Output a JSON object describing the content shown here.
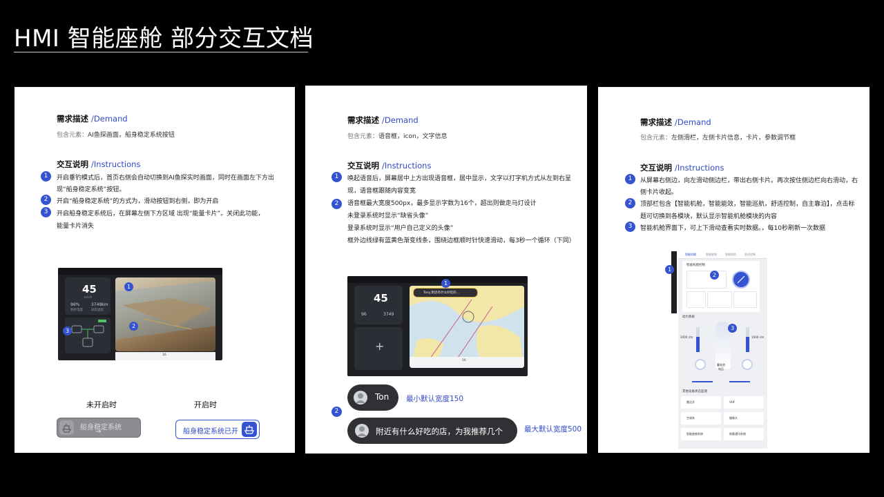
{
  "page": {
    "title": "HMI 智能座舱 部分交互文档"
  },
  "card1": {
    "demand_h": "需求描述",
    "demand_en": "/Demand",
    "elements_k": "包含元素：",
    "elements_v": "AI鱼探画面，船身稳定系统按钮",
    "instr_h": "交互说明",
    "instr_en": "/Instructions",
    "items": [
      "开启垂钓模式后，首页右侧会自动切换到AI鱼探实时画面，同时在画面左下方出",
      "现“船身稳定系统”按钮。",
      "开启“船身稳定系统”的方式为，滑动按钮到右侧，即为开启",
      "开启船身稳定系统后，在屏幕左侧下方区域 出现“能量卡片”。关闭此功能，",
      "能量卡片消失"
    ],
    "screen": {
      "speed": "45",
      "unit": "km/h",
      "val1": "96",
      "val1u": "%",
      "val2": "3749",
      "val2u": "km",
      "gear": "16",
      "sub1": "剩余电量",
      "sub2": "续航里程"
    },
    "cap_off": "未开启时",
    "cap_on": "开启时",
    "btn_off": "船身稳定系统",
    "btn_arrow": "→",
    "btn_on": "船身稳定系统已开"
  },
  "card2": {
    "demand_h": "需求描述",
    "demand_en": "/Demand",
    "elements_k": "包含元素：",
    "elements_v": "语音框，icon，文字信息",
    "instr_h": "交互说明",
    "instr_en": "/Instructions",
    "items": [
      "唤起语音后，屏幕居中上方出现语音框，居中显示，文字以打字机方式从左到右呈",
      "现，语音框跟随内容变宽",
      "语音框最大宽度500px，最多显示字数为16个，超出则做走马灯设计",
      "未登录系统时显示“缺省头像”",
      "登录系统时显示“用户自己定义的头像”",
      "框外边线绿有蓝黄色渐变线条，围绕边框顺时针快速滑动，每3秒一个循环（下同）"
    ],
    "screen": {
      "speed": "45",
      "val1": "96",
      "val2": "3749",
      "plus": "+",
      "voice": "Tony,附近有什么好吃的...",
      "gear": "16"
    },
    "pill1": "Ton",
    "lbl1": "最小默认宽度150",
    "pill2": "附近有什么好吃的店，为我推荐几个",
    "lbl2": "最大默认宽度500"
  },
  "card3": {
    "demand_h": "需求描述",
    "demand_en": "/Demand",
    "elements_k": "包含元素：",
    "elements_v": "左侧滑栏，左侧卡片信息，卡片，参数调节框",
    "instr_h": "交互说明",
    "instr_en": "/Instructions",
    "items": [
      "从屏幕右侧边，向左滑动侧边栏，带出右侧卡片。再次按住侧边栏向右滑动，右",
      "侧卡片收起。",
      "顶部栏包含【智能机舱，智能能效，智能巡航，舒适控制，自主靠泊】，点击标",
      "题可切换到各模块，默认显示智能机舱模块的内容",
      "智能机舱界面下，可上下滑动查看实时数据。，每10秒刷新一次数据"
    ],
    "phone": {
      "tabs": [
        "智能机舱",
        "智能能效",
        "智能巡航",
        "舒适控制"
      ],
      "card_title": "智能机舱控制",
      "power_title": "动力系统",
      "left_val": "1000 r/m",
      "right_val": "1000 r/m",
      "center_val": "蓄电池",
      "center_sub": "电压",
      "other_title": "其他设备状态监测",
      "devices": [
        "雷达开",
        "VHF",
        "空调系",
        "摄像头",
        "智能座舱系统",
        "船载通讯系统"
      ]
    }
  },
  "numbers": [
    "1",
    "2",
    "3"
  ]
}
